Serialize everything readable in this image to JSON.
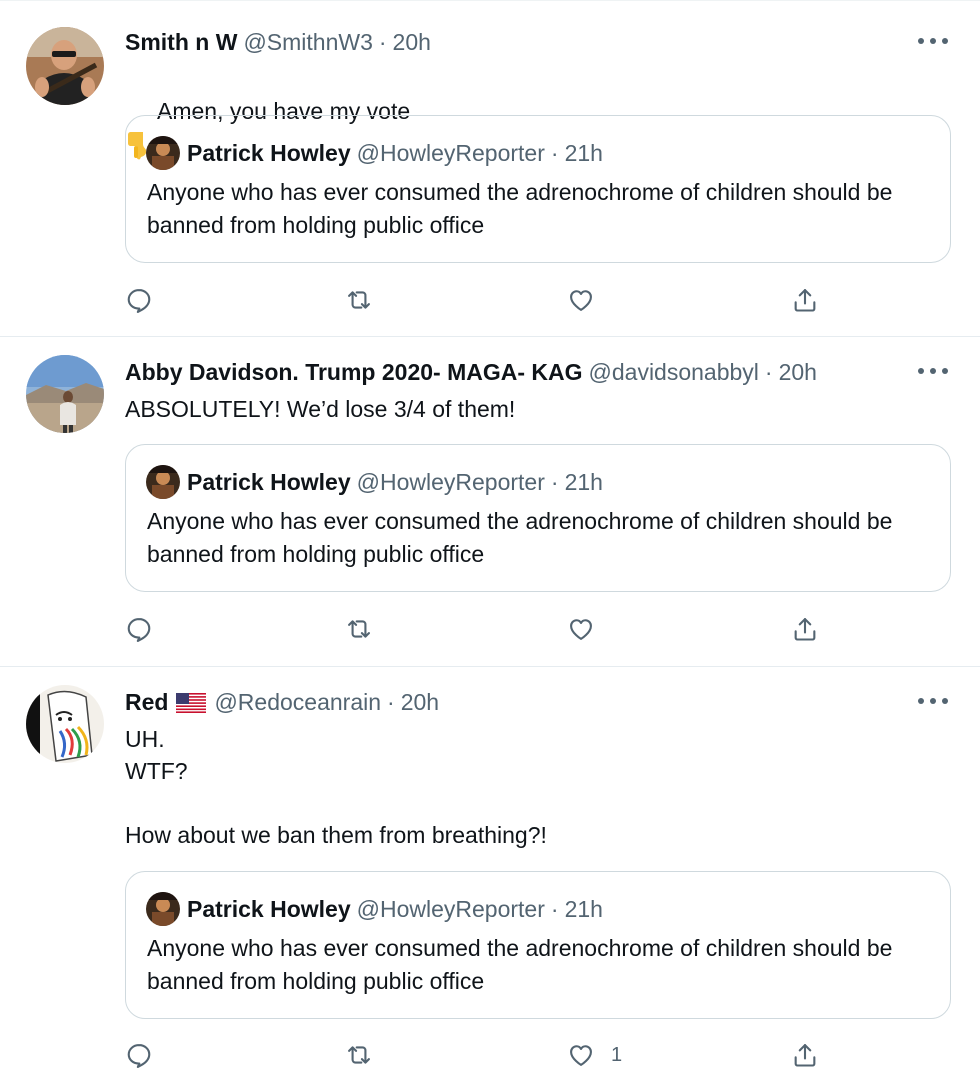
{
  "colors": {
    "text_primary": "#0f1419",
    "text_secondary": "#536471",
    "border": "#cfd9de",
    "divider": "#e6ecf0"
  },
  "tweets": [
    {
      "author": {
        "name": "Smith n W",
        "handle": "@SmithnW3",
        "time": "20h",
        "avatar_icon": "avatar-photo-man-with-rifle"
      },
      "emoji_icon": "backhand-index-pointing-down",
      "text": "Amen, you have my vote",
      "quoted": {
        "name": "Patrick Howley",
        "handle": "@HowleyReporter",
        "time": "21h",
        "text": "Anyone who has ever consumed the adrenochrome of children should be banned from holding public office"
      },
      "actions": {
        "reply": "",
        "retweet": "",
        "like": "",
        "share": ""
      }
    },
    {
      "author": {
        "name": "Abby Davidson. Trump 2020- MAGA- KAG",
        "handle": "@davidsonabbyl",
        "time": "20h",
        "avatar_icon": "avatar-photo-person-desert"
      },
      "text": "ABSOLUTELY!  We’d lose 3/4 of them!",
      "quoted": {
        "name": "Patrick Howley",
        "handle": "@HowleyReporter",
        "time": "21h",
        "text": "Anyone who has ever consumed the adrenochrome of children should be banned from holding public office"
      },
      "actions": {
        "reply": "",
        "retweet": "",
        "like": "",
        "share": ""
      }
    },
    {
      "author": {
        "name": "Red",
        "flag_icon": "us-flag",
        "handle": "@Redoceanrain",
        "time": "20h",
        "avatar_icon": "avatar-drawing-colorful"
      },
      "text": "UH.\nWTF?\n\nHow about we ban them from breathing?!",
      "quoted": {
        "name": "Patrick Howley",
        "handle": "@HowleyReporter",
        "time": "21h",
        "text": "Anyone who has ever consumed the adrenochrome of children should be banned from holding public office"
      },
      "actions": {
        "reply": "",
        "retweet": "",
        "like": "1",
        "share": ""
      }
    }
  ],
  "separator": "·"
}
